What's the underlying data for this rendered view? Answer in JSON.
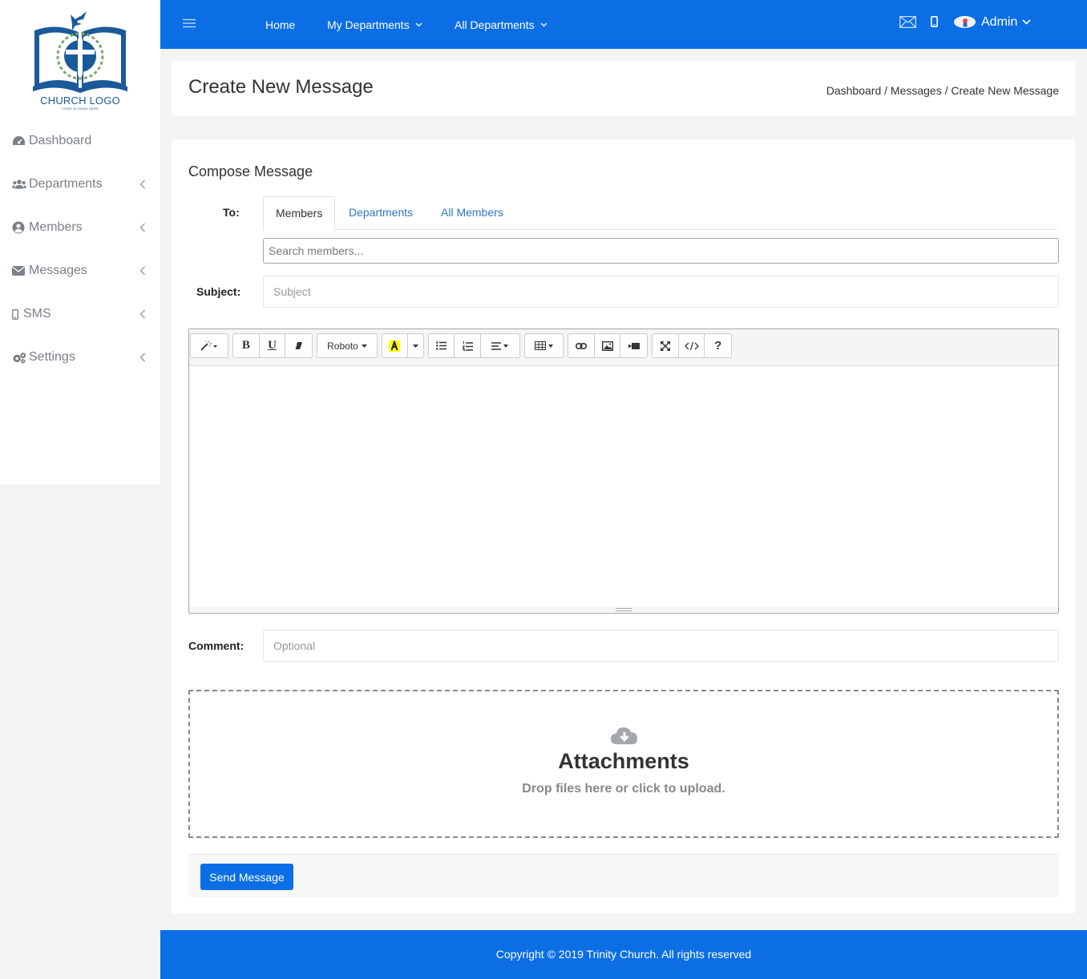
{
  "sidebar": {
    "logo_text": "CHURCH LOGO",
    "logo_slogan": "YOUR SLOGAN HERE",
    "items": [
      {
        "label": "Dashboard",
        "icon": "dashboard-icon"
      },
      {
        "label": "Departments",
        "icon": "users-icon"
      },
      {
        "label": "Members",
        "icon": "user-circle-icon"
      },
      {
        "label": "Messages",
        "icon": "envelope-icon"
      },
      {
        "label": "SMS",
        "icon": "mobile-icon"
      },
      {
        "label": "Settings",
        "icon": "gears-icon"
      }
    ]
  },
  "topbar": {
    "home": "Home",
    "my_departments": "My Departments",
    "all_departments": "All Departments",
    "user": "Admin"
  },
  "page": {
    "title": "Create New Message",
    "breadcrumb": "Dashboard / Messages / Create New Message"
  },
  "compose": {
    "title": "Compose Message",
    "to_label": "To:",
    "tabs": [
      "Members",
      "Departments",
      "All Members"
    ],
    "search_placeholder": "Search members...",
    "subject_label": "Subject:",
    "subject_placeholder": "Subject",
    "comment_label": "Comment:",
    "comment_placeholder": "Optional",
    "font_name": "Roboto",
    "dropzone_title": "Attachments",
    "dropzone_sub": "Drop files here or click to upload.",
    "send_label": "Send Message"
  },
  "footer": {
    "copyright": "Copyright © 2019 Trinity Church. All rights reserved"
  },
  "colors": {
    "primary": "#0b6ee5",
    "link": "#2a78c6",
    "logo": "#1a5a9a"
  }
}
